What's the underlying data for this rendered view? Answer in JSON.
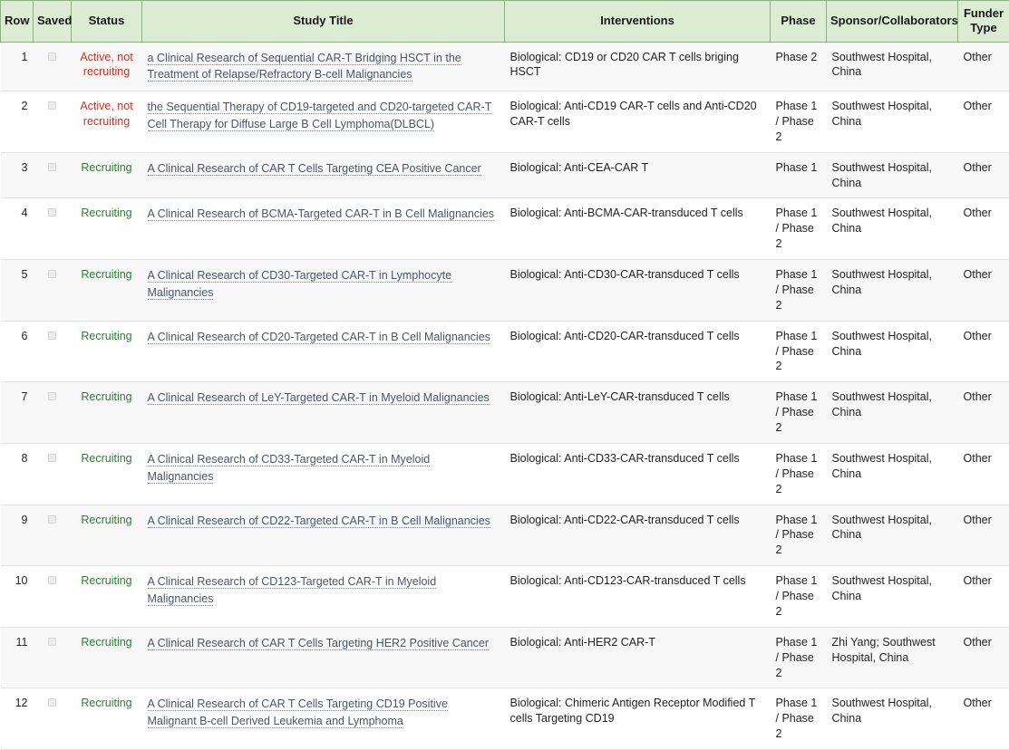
{
  "table": {
    "columns": [
      {
        "key": "row",
        "label": "Row"
      },
      {
        "key": "saved",
        "label": "Saved"
      },
      {
        "key": "status",
        "label": "Status"
      },
      {
        "key": "title",
        "label": "Study Title"
      },
      {
        "key": "interventions",
        "label": "Interventions"
      },
      {
        "key": "phase",
        "label": "Phase"
      },
      {
        "key": "sponsor",
        "label": "Sponsor/Collaborators"
      },
      {
        "key": "funder",
        "label": "Funder Type"
      }
    ],
    "colors": {
      "header_background": "#dcecd2",
      "header_border": "#8fae84",
      "status_recruiting": "#2e7d32",
      "status_active_not_recruiting": "#cc3322",
      "link": "#4a5568",
      "row_odd_background": "#f8f8f8",
      "row_even_background": "#ffffff"
    },
    "saved_icon": "checkbox-unchecked-icon",
    "rows": [
      {
        "row": "1",
        "status": "Active, not recruiting",
        "status_kind": "active-not-recruiting",
        "title": "a Clinical Research of Sequential CAR-T Bridging HSCT in the Treatment of Relapse/Refractory B-cell Malignancies",
        "interventions": "Biological: CD19 or CD20 CAR T cells briging HSCT",
        "phase": "Phase 2",
        "sponsor": "Southwest Hospital, China",
        "funder": "Other"
      },
      {
        "row": "2",
        "status": "Active, not recruiting",
        "status_kind": "active-not-recruiting",
        "title": "the Sequential Therapy of CD19-targeted and CD20-targeted CAR-T Cell Therapy for Diffuse Large B Cell Lymphoma(DLBCL)",
        "interventions": "Biological: Anti-CD19 CAR-T cells and Anti-CD20 CAR-T cells",
        "phase": "Phase 1 / Phase 2",
        "sponsor": "Southwest Hospital, China",
        "funder": "Other"
      },
      {
        "row": "3",
        "status": "Recruiting",
        "status_kind": "recruiting",
        "title": "A Clinical Research of CAR T Cells Targeting CEA Positive Cancer",
        "interventions": "Biological: Anti-CEA-CAR T",
        "phase": "Phase 1",
        "sponsor": "Southwest Hospital, China",
        "funder": "Other"
      },
      {
        "row": "4",
        "status": "Recruiting",
        "status_kind": "recruiting",
        "title": "A Clinical Research of BCMA-Targeted CAR-T in B Cell Malignancies",
        "interventions": "Biological: Anti-BCMA-CAR-transduced T cells",
        "phase": "Phase 1 / Phase 2",
        "sponsor": "Southwest Hospital, China",
        "funder": "Other"
      },
      {
        "row": "5",
        "status": "Recruiting",
        "status_kind": "recruiting",
        "title": "A Clinical Research of CD30-Targeted CAR-T in Lymphocyte Malignancies",
        "interventions": "Biological: Anti-CD30-CAR-transduced T cells",
        "phase": "Phase 1 / Phase 2",
        "sponsor": "Southwest Hospital, China",
        "funder": "Other"
      },
      {
        "row": "6",
        "status": "Recruiting",
        "status_kind": "recruiting",
        "title": "A Clinical Research of CD20-Targeted CAR-T in B Cell Malignancies",
        "interventions": "Biological: Anti-CD20-CAR-transduced T cells",
        "phase": "Phase 1 / Phase 2",
        "sponsor": "Southwest Hospital, China",
        "funder": "Other"
      },
      {
        "row": "7",
        "status": "Recruiting",
        "status_kind": "recruiting",
        "title": "A Clinical Research of LeY-Targeted CAR-T in Myeloid Malignancies",
        "interventions": "Biological: Anti-LeY-CAR-transduced T cells",
        "phase": "Phase 1 / Phase 2",
        "sponsor": "Southwest Hospital, China",
        "funder": "Other"
      },
      {
        "row": "8",
        "status": "Recruiting",
        "status_kind": "recruiting",
        "title": "A Clinical Research of CD33-Targeted CAR-T in Myeloid Malignancies",
        "interventions": "Biological: Anti-CD33-CAR-transduced T cells",
        "phase": "Phase 1 / Phase 2",
        "sponsor": "Southwest Hospital, China",
        "funder": "Other"
      },
      {
        "row": "9",
        "status": "Recruiting",
        "status_kind": "recruiting",
        "title": "A Clinical Research of CD22-Targeted CAR-T in B Cell Malignancies",
        "interventions": "Biological: Anti-CD22-CAR-transduced T cells",
        "phase": "Phase 1 / Phase 2",
        "sponsor": "Southwest Hospital, China",
        "funder": "Other"
      },
      {
        "row": "10",
        "status": "Recruiting",
        "status_kind": "recruiting",
        "title": "A Clinical Research of CD123-Targeted CAR-T in Myeloid Malignancies",
        "interventions": "Biological: Anti-CD123-CAR-transduced T cells",
        "phase": "Phase 1 / Phase 2",
        "sponsor": "Southwest Hospital, China",
        "funder": "Other"
      },
      {
        "row": "11",
        "status": "Recruiting",
        "status_kind": "recruiting",
        "title": "A Clinical Research of CAR T Cells Targeting HER2 Positive Cancer",
        "interventions": "Biological: Anti-HER2 CAR-T",
        "phase": "Phase 1 / Phase 2",
        "sponsor": "Zhi Yang; Southwest Hospital, China",
        "funder": "Other"
      },
      {
        "row": "12",
        "status": "Recruiting",
        "status_kind": "recruiting",
        "title": "A Clinical Research of CAR T Cells Targeting CD19 Positive Malignant B-cell Derived Leukemia and Lymphoma",
        "interventions": "Biological: Chimeric Antigen Receptor Modified T cells Targeting CD19",
        "phase": "Phase 1 / Phase 2",
        "sponsor": "Southwest Hospital, China",
        "funder": "Other"
      }
    ]
  }
}
